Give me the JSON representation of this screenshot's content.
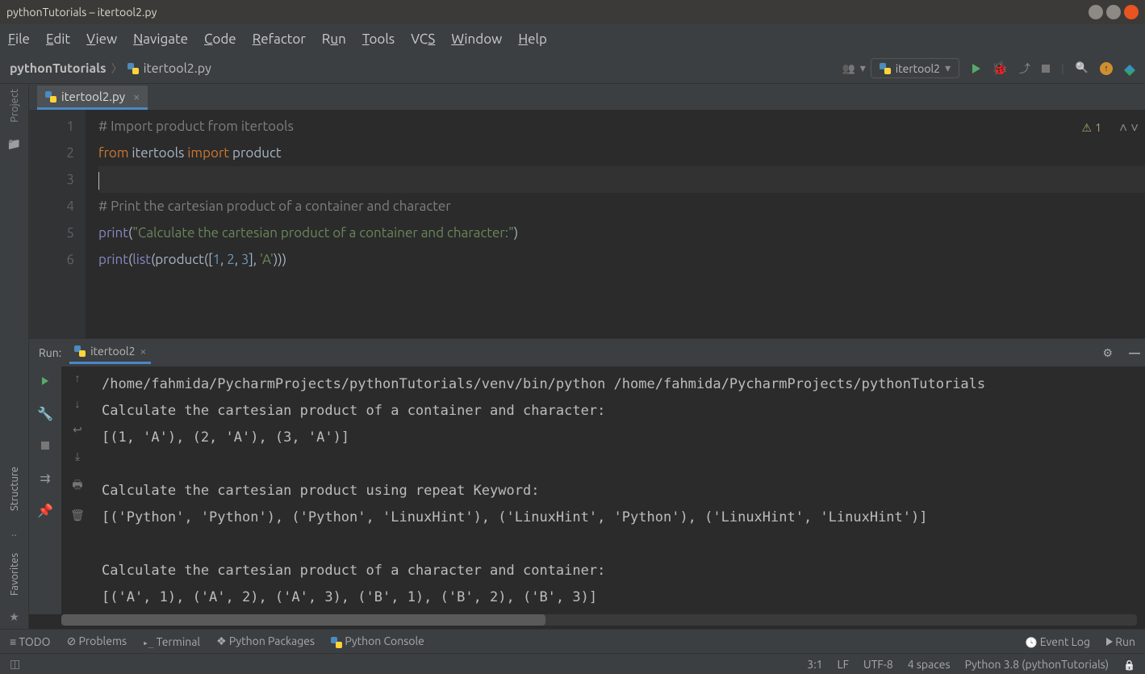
{
  "window": {
    "title": "pythonTutorials – itertool2.py"
  },
  "menu": [
    "File",
    "Edit",
    "View",
    "Navigate",
    "Code",
    "Refactor",
    "Run",
    "Tools",
    "VCS",
    "Window",
    "Help"
  ],
  "breadcrumbs": {
    "project": "pythonTutorials",
    "file": "itertool2.py"
  },
  "runconfig": {
    "name": "itertool2"
  },
  "tab": {
    "name": "itertool2.py"
  },
  "editor": {
    "warnings": "1",
    "lines": [
      {
        "n": "1",
        "segs": [
          {
            "t": "# Import product from itertools",
            "c": "c-comment"
          }
        ]
      },
      {
        "n": "2",
        "segs": [
          {
            "t": "from ",
            "c": "c-kw"
          },
          {
            "t": "itertools "
          },
          {
            "t": "import ",
            "c": "c-kw"
          },
          {
            "t": "product"
          }
        ]
      },
      {
        "n": "3",
        "segs": [],
        "current": true
      },
      {
        "n": "4",
        "segs": [
          {
            "t": "# Print the cartesian product of a container and character",
            "c": "c-comment"
          }
        ]
      },
      {
        "n": "5",
        "segs": [
          {
            "t": "print",
            "c": "c-fn"
          },
          {
            "t": "("
          },
          {
            "t": "\"Calculate the cartesian product of a container and character:\"",
            "c": "c-str"
          },
          {
            "t": ")"
          }
        ]
      },
      {
        "n": "6",
        "segs": [
          {
            "t": "print",
            "c": "c-fn"
          },
          {
            "t": "("
          },
          {
            "t": "list",
            "c": "c-fn"
          },
          {
            "t": "(product(["
          },
          {
            "t": "1",
            "c": "c-num"
          },
          {
            "t": ", "
          },
          {
            "t": "2",
            "c": "c-num"
          },
          {
            "t": ", "
          },
          {
            "t": "3",
            "c": "c-num"
          },
          {
            "t": "], "
          },
          {
            "t": "'A'",
            "c": "c-str"
          },
          {
            "t": ")))"
          }
        ]
      }
    ]
  },
  "run": {
    "label": "Run:",
    "tab": "itertool2",
    "output": "/home/fahmida/PycharmProjects/pythonTutorials/venv/bin/python /home/fahmida/PycharmProjects/pythonTutorials\nCalculate the cartesian product of a container and character:\n[(1, 'A'), (2, 'A'), (3, 'A')]\n\nCalculate the cartesian product using repeat Keyword:\n[('Python', 'Python'), ('Python', 'LinuxHint'), ('LinuxHint', 'Python'), ('LinuxHint', 'LinuxHint')]\n\nCalculate the cartesian product of a character and container:\n[('A', 1), ('A', 2), ('A', 3), ('B', 1), ('B', 2), ('B', 3)]"
  },
  "left": {
    "project": "Project",
    "structure": "Structure",
    "favorites": "Favorites"
  },
  "bottom": {
    "todo": "TODO",
    "problems": "Problems",
    "terminal": "Terminal",
    "pkg": "Python Packages",
    "console": "Python Console",
    "eventlog": "Event Log",
    "run": "Run"
  },
  "status": {
    "pos": "3:1",
    "sep": "LF",
    "enc": "UTF-8",
    "indent": "4 spaces",
    "interp": "Python 3.8 (pythonTutorials)"
  }
}
